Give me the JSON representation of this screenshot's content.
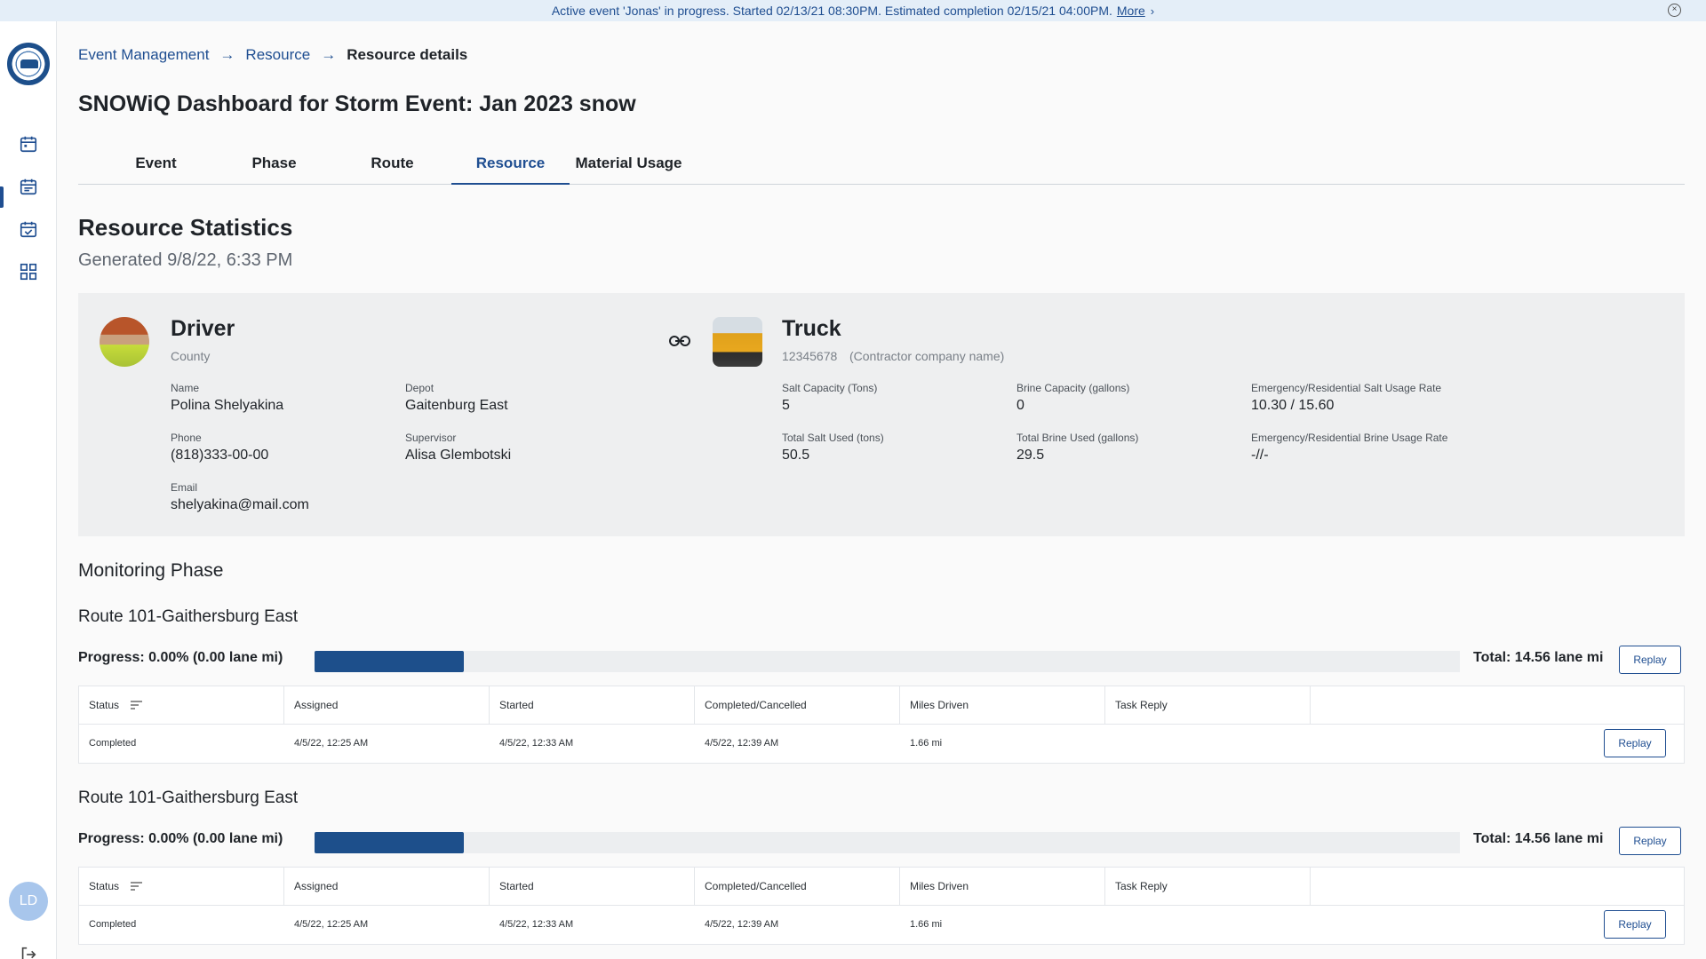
{
  "banner": {
    "message": "Active event 'Jonas' in progress. Started 02/13/21 08:30PM. Estimated completion 02/15/21 04:00PM.",
    "more_label": "More",
    "more_chevron": "›",
    "close_glyph": "×"
  },
  "sidebar": {
    "items": [
      {
        "name": "calendar-icon"
      },
      {
        "name": "calendar-icon",
        "active": true
      },
      {
        "name": "calendar-check-icon"
      },
      {
        "name": "grid-icon"
      }
    ],
    "user_initials": "LD",
    "accent_color": "#1f4e91"
  },
  "breadcrumb": {
    "items": [
      "Event Management",
      "Resource"
    ],
    "current": "Resource details",
    "separator": "→"
  },
  "page": {
    "title": "SNOWiQ Dashboard for Storm Event:  Jan 2023 snow"
  },
  "tabs": [
    "Event",
    "Phase",
    "Route",
    "Resource",
    "Material Usage"
  ],
  "active_tab": "Resource",
  "stats": {
    "title": "Resource Statistics",
    "generated": "Generated 9/8/22, 6:33 PM"
  },
  "driver": {
    "heading": "Driver",
    "subtitle": "County",
    "name_label": "Name",
    "name": "Polina Shelyakina",
    "depot_label": "Depot",
    "depot": "Gaitenburg East",
    "phone_label": "Phone",
    "phone": "(818)333-00-00",
    "supervisor_label": "Supervisor",
    "supervisor": "Alisa Glembotski",
    "email_label": "Email",
    "email": "shelyakina@mail.com"
  },
  "truck": {
    "heading": "Truck",
    "id": "12345678",
    "company": "(Contractor company name)",
    "salt_capacity_label": "Salt Capacity (Tons)",
    "salt_capacity": "5",
    "brine_capacity_label": "Brine Capacity (gallons)",
    "brine_capacity": "0",
    "salt_rate_label": "Emergency/Residential Salt Usage Rate",
    "salt_rate": "10.30 / 15.60",
    "total_salt_label": "Total Salt Used (tons)",
    "total_salt": "50.5",
    "total_brine_label": "Total Brine Used (gallons)",
    "total_brine": "29.5",
    "brine_rate_label": "Emergency/Residential Brine Usage Rate",
    "brine_rate": "-//-"
  },
  "monitoring": {
    "title": "Monitoring Phase",
    "table_headers": [
      "Status",
      "Assigned",
      "Started",
      "Completed/Cancelled",
      "Miles Driven",
      "Task Reply"
    ],
    "routes": [
      {
        "title": "Route 101-Gaithersburg East",
        "progress_label": "Progress: 0.00% (0.00 lane mi)",
        "progress_fill_fraction": 0.13,
        "total_label": "Total: 14.56 lane mi",
        "replay_label": "Replay",
        "rows": [
          {
            "status": "Completed",
            "assigned": "4/5/22, 12:25 AM",
            "started": "4/5/22, 12:33 AM",
            "completed": "4/5/22, 12:39 AM",
            "miles": "1.66 mi",
            "task_reply": "",
            "replay_label": "Replay"
          }
        ]
      },
      {
        "title": "Route 101-Gaithersburg East",
        "progress_label": "Progress: 0.00% (0.00 lane mi)",
        "progress_fill_fraction": 0.13,
        "total_label": "Total: 14.56 lane mi",
        "replay_label": "Replay",
        "rows": [
          {
            "status": "Completed",
            "assigned": "4/5/22, 12:25 AM",
            "started": "4/5/22, 12:33 AM",
            "completed": "4/5/22, 12:39 AM",
            "miles": "1.66 mi",
            "task_reply": "",
            "replay_label": "Replay"
          }
        ]
      }
    ]
  }
}
